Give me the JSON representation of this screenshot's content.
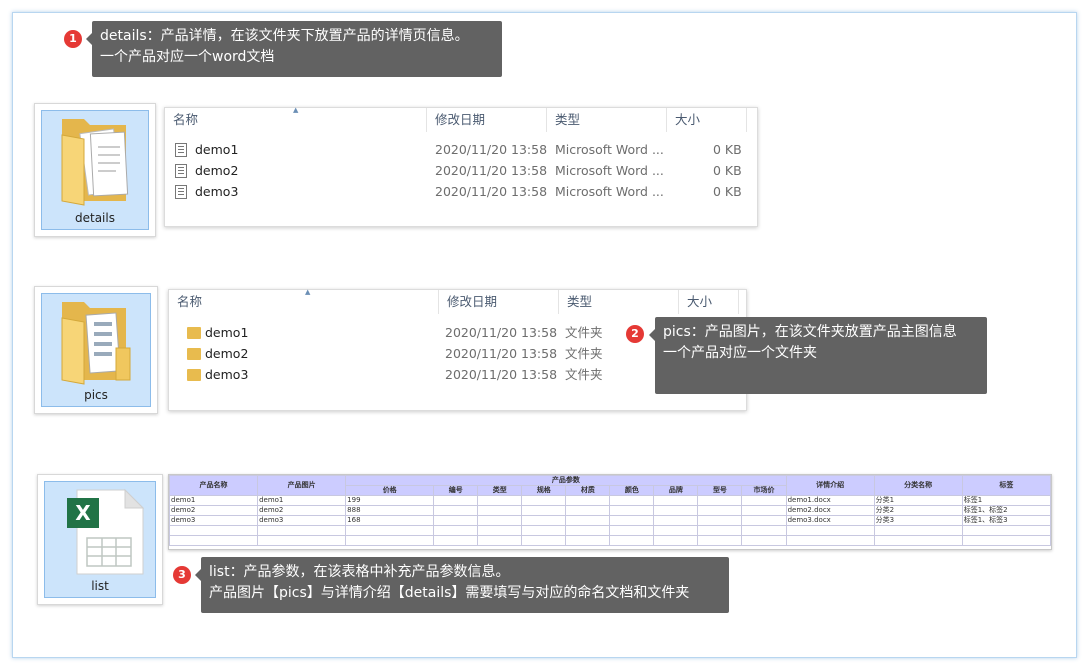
{
  "callouts": [
    {
      "num": "1",
      "line1": "details：产品详情，在该文件夹下放置产品的详情页信息。",
      "line2": "一个产品对应一个word文档"
    },
    {
      "num": "2",
      "line1": "pics：产品图片，在该文件夹放置产品主图信息",
      "line2": "一个产品对应一个文件夹"
    },
    {
      "num": "3",
      "line1": "list：产品参数，在该表格中补充产品参数信息。",
      "line2": "产品图片【pics】与详情介绍【details】需要填写与对应的命名文档和文件夹"
    }
  ],
  "tiles": {
    "details": "details",
    "pics": "pics",
    "list": "list"
  },
  "columns": {
    "name": "名称",
    "date": "修改日期",
    "type": "类型",
    "size": "大小"
  },
  "details_files": [
    {
      "name": "demo1",
      "date": "2020/11/20 13:58",
      "type": "Microsoft Word ...",
      "size": "0 KB"
    },
    {
      "name": "demo2",
      "date": "2020/11/20 13:58",
      "type": "Microsoft Word ...",
      "size": "0 KB"
    },
    {
      "name": "demo3",
      "date": "2020/11/20 13:58",
      "type": "Microsoft Word ...",
      "size": "0 KB"
    }
  ],
  "pics_folders": [
    {
      "name": "demo1",
      "date": "2020/11/20 13:58",
      "type": "文件夹"
    },
    {
      "name": "demo2",
      "date": "2020/11/20 13:58",
      "type": "文件夹"
    },
    {
      "name": "demo3",
      "date": "2020/11/20 13:58",
      "type": "文件夹"
    }
  ],
  "sheet": {
    "h_name": "产品名称",
    "h_pic": "产品图片",
    "h_params": "产品参数",
    "h_detail": "详情介绍",
    "h_cat": "分类名称",
    "h_tags": "标签",
    "sub": [
      "价格",
      "编号",
      "类型",
      "规格",
      "材质",
      "颜色",
      "品牌",
      "型号",
      "市场价"
    ],
    "rows": [
      {
        "name": "demo1",
        "pic": "demo1",
        "price": "199",
        "detail": "demo1.docx",
        "cat": "分类1",
        "tags": "标签1"
      },
      {
        "name": "demo2",
        "pic": "demo2",
        "price": "888",
        "detail": "demo2.docx",
        "cat": "分类2",
        "tags": "标签1、标签2"
      },
      {
        "name": "demo3",
        "pic": "demo3",
        "price": "168",
        "detail": "demo3.docx",
        "cat": "分类3",
        "tags": "标签1、标签3"
      }
    ]
  },
  "colors": {
    "badge": "#e53935",
    "callout_bg": "#626262",
    "tile_select": "#cce4fb",
    "excel_green": "#217346"
  }
}
